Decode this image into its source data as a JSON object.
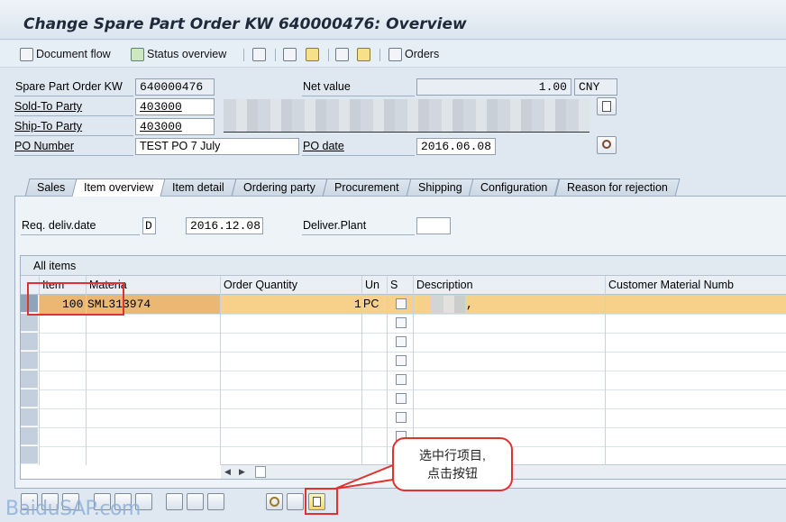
{
  "window": {
    "title": "Change Spare Part Order KW 640000476: Overview"
  },
  "toolbar": {
    "document_flow": "Document flow",
    "status_overview": "Status overview",
    "orders": "Orders",
    "icons": [
      "doc-flow-icon",
      "status-overview-icon",
      "back-icon",
      "forward-icon",
      "person-icon",
      "display-icon",
      "tools-icon",
      "orders-icon"
    ]
  },
  "header": {
    "order_label": "Spare Part Order KW",
    "order_value": "640000476",
    "net_value_label": "Net value",
    "net_value": "1.00",
    "currency": "CNY",
    "sold_to_label": "Sold-To Party",
    "sold_to_value": "403000",
    "ship_to_label": "Ship-To Party",
    "ship_to_value": "403000",
    "po_number_label": "PO Number",
    "po_number_value": "TEST PO 7 July",
    "po_date_label": "PO date",
    "po_date_value": "2016.06.08"
  },
  "tabs": [
    "Sales",
    "Item overview",
    "Item detail",
    "Ordering party",
    "Procurement",
    "Shipping",
    "Configuration",
    "Reason for rejection"
  ],
  "active_tab": "Item overview",
  "item_overview": {
    "req_deliv_label": "Req. deliv.date",
    "req_deliv_type": "D",
    "req_deliv_value": "2016.12.08",
    "deliver_plant_label": "Deliver.Plant",
    "deliver_plant_value": ""
  },
  "items_table": {
    "title": "All items",
    "columns": [
      "Item",
      "Materia",
      "Order Quantity",
      "Un",
      "S",
      "Description",
      "Customer Material Numb"
    ],
    "rows": [
      {
        "item": "100",
        "material": "SML313974",
        "quantity": "1",
        "unit": "PC",
        "description": ","
      }
    ]
  },
  "annotation": {
    "callout_line1": "选中行项目,",
    "callout_line2": "点击按钮"
  },
  "watermark": "BaiduSAP.com",
  "colors": {
    "selected_row": "#f7d08a",
    "highlight": "#e0322e"
  }
}
